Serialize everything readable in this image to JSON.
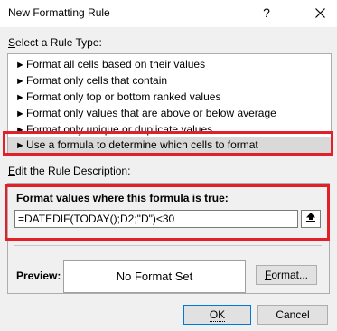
{
  "dialog": {
    "title": "New Formatting Rule",
    "help_glyph": "?",
    "close_icon": "close-icon"
  },
  "rule_type": {
    "label_first": "S",
    "label_rest": "elect a Rule Type:",
    "arrow": "►",
    "items": [
      "Format all cells based on their values",
      "Format only cells that contain",
      "Format only top or bottom ranked values",
      "Format only values that are above or below average",
      "Format only unique or duplicate values",
      "Use a formula to determine which cells to format"
    ],
    "selected_index": 5
  },
  "description": {
    "label_first": "E",
    "label_rest": "dit the Rule Description:",
    "formula_label_first": "F",
    "formula_label_mid": "o",
    "formula_label_rest": "rmat values where this formula is true:",
    "formula_value": "=DATEDIF(TODAY();D2;\"D\")<30",
    "collapse_icon": "collapse-dialog-icon",
    "preview_label": "Preview:",
    "preview_text": "No Format Set",
    "format_button_first": "F",
    "format_button_rest": "ormat..."
  },
  "buttons": {
    "ok": "OK",
    "cancel": "Cancel"
  },
  "colors": {
    "highlight_border": "#e3202a",
    "selected_row": "#d9d9d9",
    "focus_blue": "#0078d7"
  }
}
